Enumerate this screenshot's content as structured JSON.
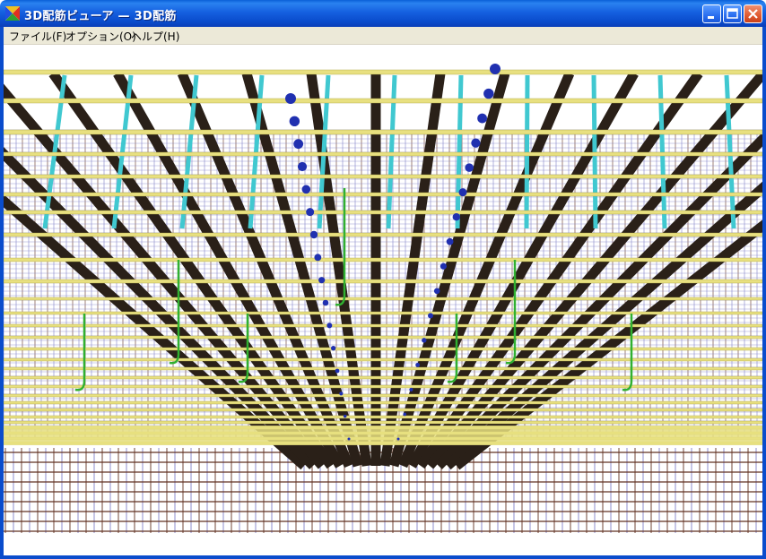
{
  "window": {
    "title": "3D配筋ビューア — 3D配筋",
    "icon": "app-logo-icon",
    "controls": {
      "minimize": "minimize-icon",
      "maximize": "maximize-icon",
      "close": "close-icon"
    }
  },
  "menu": {
    "items": [
      {
        "label": "ファイル(F)"
      },
      {
        "label": "オプション(O)"
      },
      {
        "label": "ヘルプ(H)"
      }
    ]
  },
  "scene": {
    "description_colors": {
      "longitudinal_bars": "#e8e080",
      "stirrups": "#40c8d0",
      "dark_bars": "#2a2018",
      "mesh": "#8080c8",
      "mesh_dark": "#603020",
      "joints": "#2030b0",
      "hooks": "#30b030"
    }
  }
}
